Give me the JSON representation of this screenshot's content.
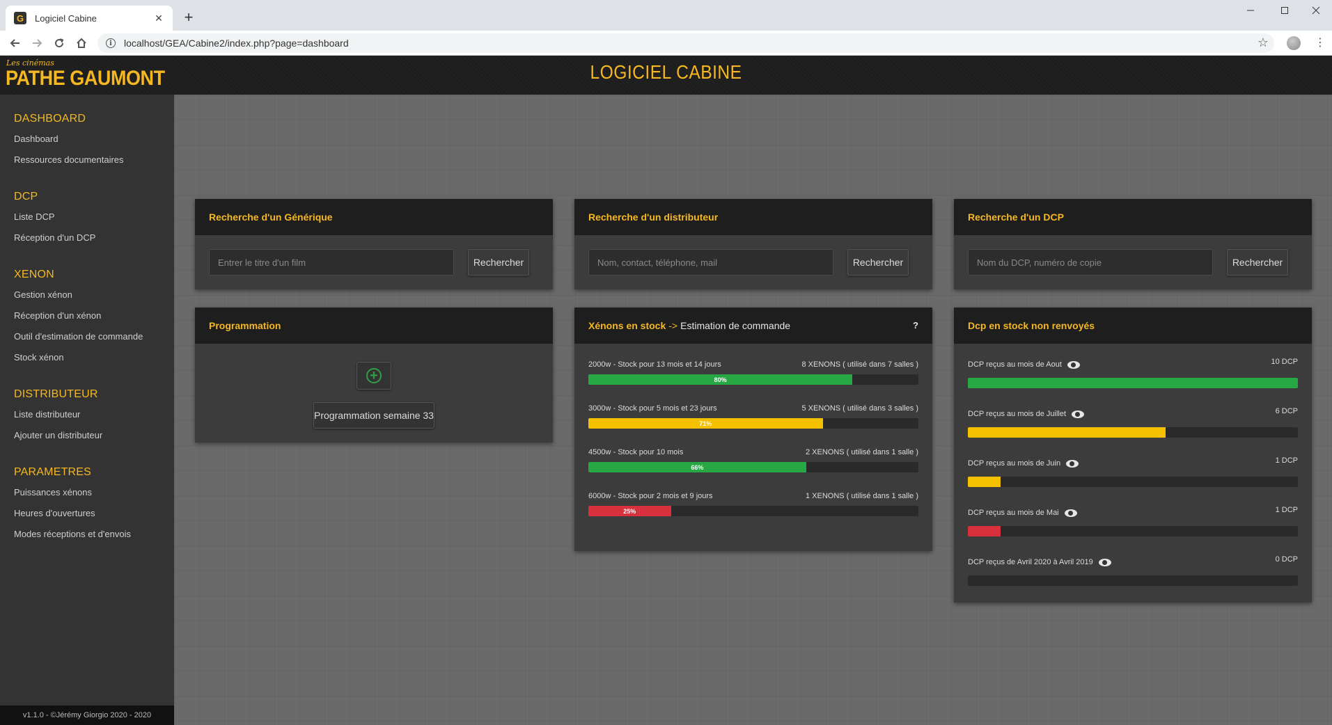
{
  "browser": {
    "tab_title": "Logiciel Cabine",
    "tab_favicon": "G",
    "close_glyph": "✕",
    "newtab_glyph": "+",
    "url": "localhost/GEA/Cabine2/index.php?page=dashboard"
  },
  "header": {
    "logo_small": "Les cinémas",
    "logo_big": "PATHE GAUMONT",
    "title": "LOGICIEL CABINE"
  },
  "sidebar": {
    "sections": [
      {
        "heading": "DASHBOARD",
        "items": [
          "Dashboard",
          "Ressources documentaires"
        ]
      },
      {
        "heading": "DCP",
        "items": [
          "Liste DCP",
          "Réception d'un DCP"
        ]
      },
      {
        "heading": "XENON",
        "items": [
          "Gestion xénon",
          "Réception d'un xénon",
          "Outil d'estimation de commande",
          "Stock xénon"
        ]
      },
      {
        "heading": "DISTRIBUTEUR",
        "items": [
          "Liste distributeur",
          "Ajouter un distributeur"
        ]
      },
      {
        "heading": "PARAMETRES",
        "items": [
          "Puissances xénons",
          "Heures d'ouvertures",
          "Modes réceptions et d'envois"
        ]
      }
    ],
    "footer": "v1.1.0 - ©Jérémy Giorgio 2020 - 2020"
  },
  "search_generique": {
    "title": "Recherche d'un Générique",
    "placeholder": "Entrer le titre d'un film",
    "button": "Rechercher"
  },
  "search_distributeur": {
    "title": "Recherche d'un distributeur",
    "placeholder": "Nom, contact, téléphone, mail",
    "button": "Rechercher"
  },
  "search_dcp": {
    "title": "Recherche d'un DCP",
    "placeholder": "Nom du DCP, numéro de copie",
    "button": "Rechercher"
  },
  "programmation": {
    "title": "Programmation",
    "add_glyph": "+",
    "week_button": "Programmation semaine 33"
  },
  "xenons": {
    "title": "Xénons en stock",
    "title_arrow": "->",
    "title_suffix": "Estimation de commande",
    "help": "?",
    "colors": {
      "green": "#28a745",
      "yellow": "#f5c000",
      "red": "#d9303e"
    },
    "rows": [
      {
        "label": "2000w - Stock pour 13 mois et 14 jours",
        "right": "8 XENONS ( utilisé dans 7 salles )",
        "percent": 80,
        "percent_label": "80%",
        "color": "green"
      },
      {
        "label": "3000w - Stock pour 5 mois et 23 jours",
        "right": "5 XENONS ( utilisé dans 3 salles )",
        "percent": 71,
        "percent_label": "71%",
        "color": "yellow"
      },
      {
        "label": "4500w - Stock pour 10 mois",
        "right": "2 XENONS ( utilisé dans 1 salle )",
        "percent": 66,
        "percent_label": "66%",
        "color": "green"
      },
      {
        "label": "6000w - Stock pour 2 mois et 9 jours",
        "right": "1 XENONS ( utilisé dans 1 salle )",
        "percent": 25,
        "percent_label": "25%",
        "color": "red"
      }
    ]
  },
  "dcp_stock": {
    "title": "Dcp en stock non renvoyés",
    "rows": [
      {
        "label": "DCP reçus au mois de Aout",
        "right": "10 DCP",
        "fraction": 1.0,
        "color": "green"
      },
      {
        "label": "DCP reçus au mois de Juillet",
        "right": "6 DCP",
        "fraction": 0.6,
        "color": "yellow"
      },
      {
        "label": "DCP reçus au mois de Juin",
        "right": "1 DCP",
        "fraction": 0.1,
        "color": "yellow"
      },
      {
        "label": "DCP reçus au mois de Mai",
        "right": "1 DCP",
        "fraction": 0.1,
        "color": "red"
      },
      {
        "label": "DCP reçus de Avril 2020 à Avril 2019",
        "right": "0 DCP",
        "fraction": 0.0,
        "color": "green"
      }
    ]
  }
}
